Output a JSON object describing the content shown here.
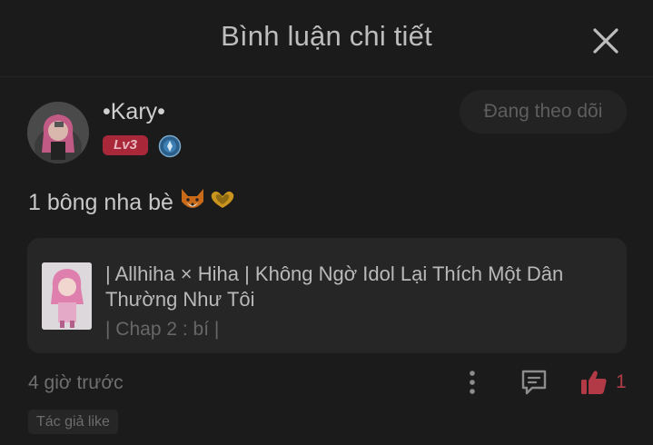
{
  "header": {
    "title": "Bình luận chi tiết",
    "close_icon": "close-icon"
  },
  "user": {
    "name": "•Kary•",
    "level": "Lv3",
    "follow_label": "Đang theo dõi"
  },
  "comment": {
    "text": "1 bông nha bè",
    "emojis": [
      "fox-emoji",
      "heart-hands-emoji"
    ]
  },
  "story": {
    "title": "| Allhiha × Hiha | Không Ngờ Idol Lại Thích Một Dân Thường Như Tôi",
    "chapter": "| Chap 2 : bí |"
  },
  "footer": {
    "time": "4 giờ trước",
    "like_count": "1",
    "author_like_label": "Tác giả like"
  },
  "colors": {
    "background": "#1b1b1b",
    "card": "#262626",
    "accent_red": "#b23a46",
    "level_badge": "#a8283a"
  }
}
